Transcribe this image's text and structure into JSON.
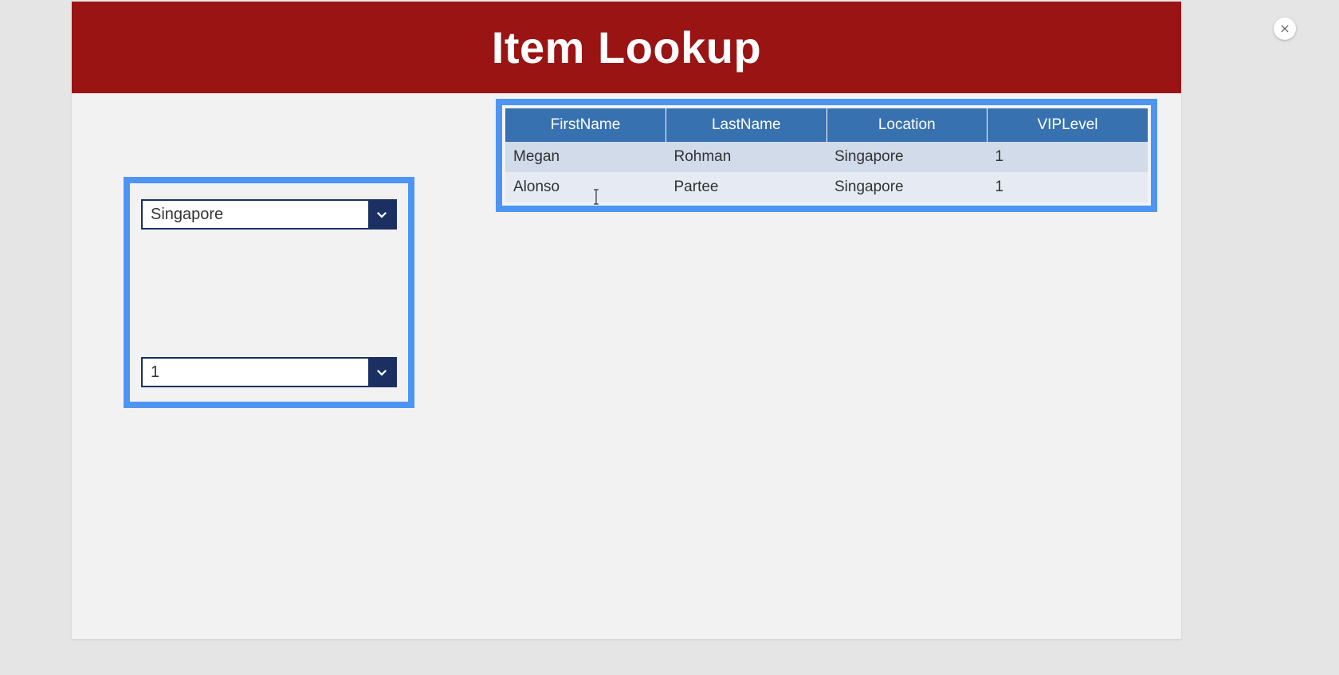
{
  "header": {
    "title": "Item Lookup"
  },
  "filters": {
    "location_selected": "Singapore",
    "vip_selected": "1"
  },
  "table": {
    "columns": [
      "FirstName",
      "LastName",
      "Location",
      "VIPLevel"
    ],
    "rows": [
      {
        "firstname": "Megan",
        "lastname": "Rohman",
        "location": "Singapore",
        "viplevel": "1"
      },
      {
        "firstname": "Alonso",
        "lastname": "Partee",
        "location": "Singapore",
        "viplevel": "1"
      }
    ]
  }
}
